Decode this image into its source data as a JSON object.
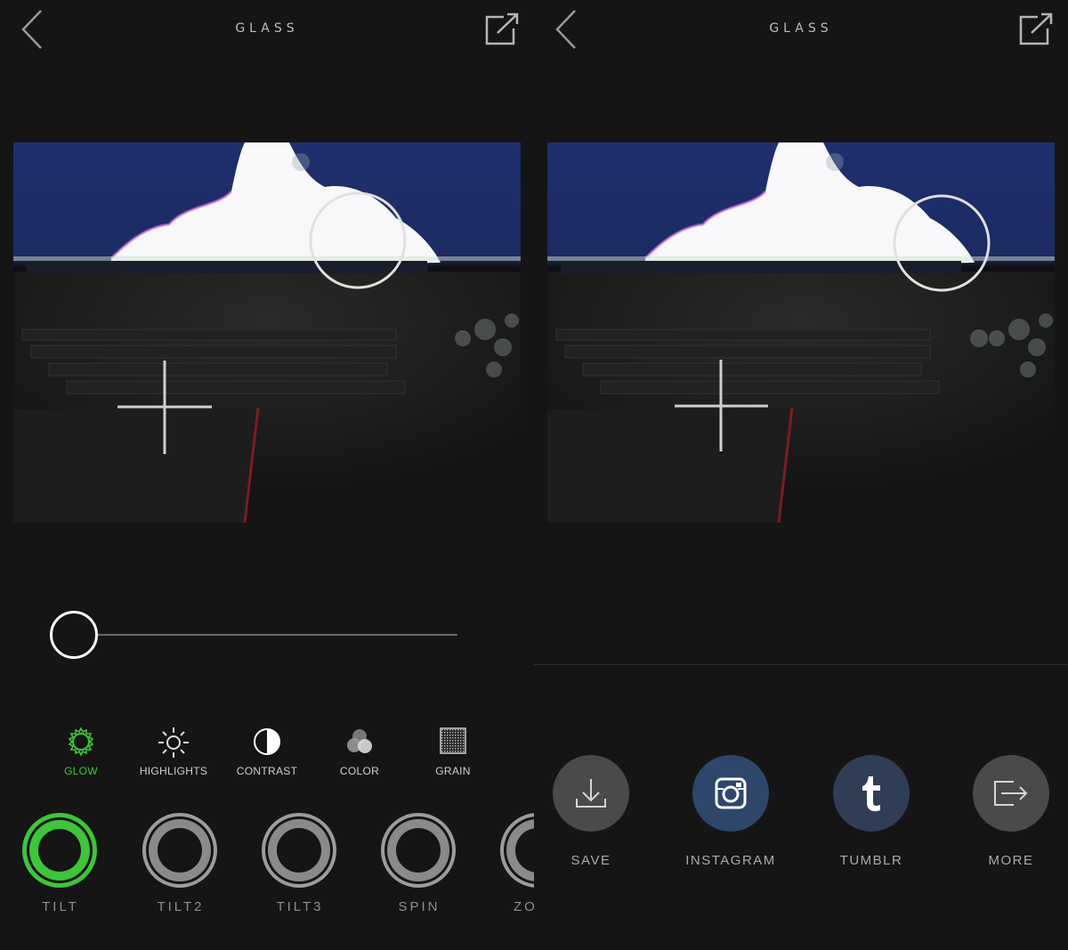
{
  "left_screen": {
    "title": "GLASS",
    "back_icon": "chevron-left-icon",
    "share_icon": "share-out-icon",
    "slider": {
      "value": 0.0
    },
    "tools": [
      {
        "label": "GLOW",
        "icon": "glow-sun-icon",
        "active": true
      },
      {
        "label": "HIGHLIGHTS",
        "icon": "sun-rays-icon",
        "active": false
      },
      {
        "label": "CONTRAST",
        "icon": "half-circle-icon",
        "active": false
      },
      {
        "label": "COLOR",
        "icon": "color-circles-icon",
        "active": false
      },
      {
        "label": "GRAIN",
        "icon": "grain-square-icon",
        "active": false
      }
    ],
    "filters": [
      {
        "label": "TILT",
        "active": true
      },
      {
        "label": "TILT2",
        "active": false
      },
      {
        "label": "TILT3",
        "active": false
      },
      {
        "label": "SPIN",
        "active": false
      },
      {
        "label": "ZO",
        "active": false
      }
    ]
  },
  "right_screen": {
    "title": "GLASS",
    "back_icon": "chevron-left-icon",
    "share_icon": "share-out-icon",
    "share_options": [
      {
        "label": "SAVE",
        "icon": "download-icon",
        "color": "#4a4a4a"
      },
      {
        "label": "INSTAGRAM",
        "icon": "instagram-icon",
        "color": "#2e466a"
      },
      {
        "label": "TUMBLR",
        "icon": "tumblr-icon",
        "color": "#2f3d55"
      },
      {
        "label": "MORE",
        "icon": "export-more-icon",
        "color": "#4a4a4a"
      }
    ]
  },
  "colors": {
    "accent_green": "#3ec53a",
    "background": "#151515"
  }
}
